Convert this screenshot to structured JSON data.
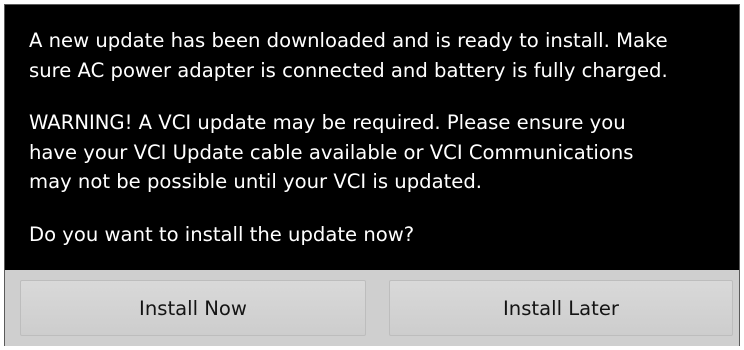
{
  "dialog": {
    "paragraphs": [
      [
        "A new update has been downloaded and is ready to install. Make",
        "sure AC power adapter is connected and battery is fully charged."
      ],
      [
        "WARNING! A VCI update may be required. Please ensure you",
        "have your VCI Update cable available or VCI Communications",
        "may not be possible until your VCI is updated."
      ],
      [
        "Do you want to install the update now?"
      ]
    ],
    "buttons": {
      "install_now": "Install Now",
      "install_later": "Install Later"
    }
  }
}
